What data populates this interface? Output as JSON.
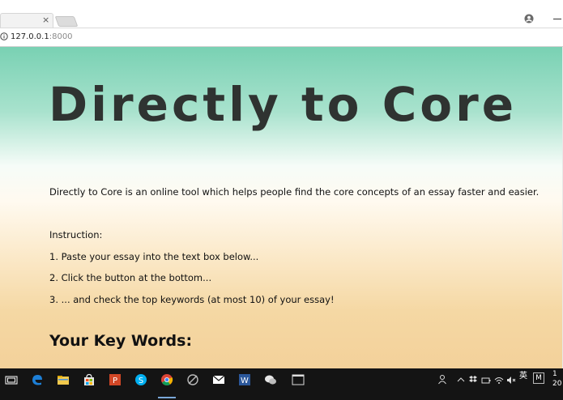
{
  "browser": {
    "tab_close": "×",
    "url_host": "127.0.0.1",
    "url_port": ":8000",
    "icons": [
      "close-icon",
      "new-tab-icon",
      "profile-icon",
      "info-icon"
    ]
  },
  "page": {
    "title": "Directly to Core",
    "description": "Directly to Core is an online tool which helps people find the core concepts of an essay faster and easier.",
    "instruction_label": "Instruction:",
    "steps": [
      "1. Paste your essay into the text box below...",
      "2. Click the button at the bottom...",
      "3. ... and check the top keywords (at most 10) of your essay!"
    ],
    "keywords_heading": "Your Key Words:"
  },
  "taskbar": {
    "apps": [
      "task-view-icon",
      "edge-icon",
      "file-explorer-icon",
      "store-icon",
      "powerpoint-icon",
      "skype-icon",
      "chrome-icon",
      "app-icon",
      "mail-icon",
      "word-icon",
      "wechat-icon",
      "terminal-icon"
    ],
    "tray_ime": "英",
    "tray_m": "M",
    "clock": "1\n20"
  },
  "colors": {
    "gradient_top": "#79d1b3",
    "gradient_mid": "#fffaf0",
    "gradient_bottom": "#f3d19a",
    "title_color": "#2f3331",
    "taskbar": "#141414"
  }
}
